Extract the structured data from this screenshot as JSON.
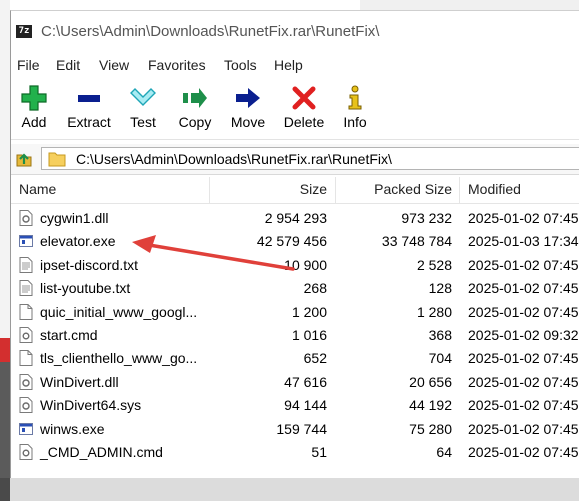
{
  "window": {
    "title": "C:\\Users\\Admin\\Downloads\\RunetFix.rar\\RunetFix\\",
    "app_icon_text": "7z"
  },
  "menu": [
    "File",
    "Edit",
    "View",
    "Favorites",
    "Tools",
    "Help"
  ],
  "toolbar": {
    "add": "Add",
    "extract": "Extract",
    "test": "Test",
    "copy": "Copy",
    "move": "Move",
    "delete": "Delete",
    "info": "Info"
  },
  "address": {
    "path": "C:\\Users\\Admin\\Downloads\\RunetFix.rar\\RunetFix\\"
  },
  "columns": {
    "name": "Name",
    "size": "Size",
    "packed": "Packed Size",
    "modified": "Modified"
  },
  "files": [
    {
      "name": "cygwin1.dll",
      "size": "2 954 293",
      "packed": "973 232",
      "modified": "2025-01-02 07:45",
      "icon": "dll-icon"
    },
    {
      "name": "elevator.exe",
      "size": "42 579 456",
      "packed": "33 748 784",
      "modified": "2025-01-03 17:34",
      "icon": "exe-icon"
    },
    {
      "name": "ipset-discord.txt",
      "size": "10 900",
      "packed": "2 528",
      "modified": "2025-01-02 07:45",
      "icon": "txt-icon"
    },
    {
      "name": "list-youtube.txt",
      "size": "268",
      "packed": "128",
      "modified": "2025-01-02 07:45",
      "icon": "txt-icon"
    },
    {
      "name": "quic_initial_www_googl...",
      "size": "1 200",
      "packed": "1 280",
      "modified": "2025-01-02 07:45",
      "icon": "file-icon"
    },
    {
      "name": "start.cmd",
      "size": "1 016",
      "packed": "368",
      "modified": "2025-01-02 09:32",
      "icon": "cmd-icon"
    },
    {
      "name": "tls_clienthello_www_go...",
      "size": "652",
      "packed": "704",
      "modified": "2025-01-02 07:45",
      "icon": "file-icon"
    },
    {
      "name": "WinDivert.dll",
      "size": "47 616",
      "packed": "20 656",
      "modified": "2025-01-02 07:45",
      "icon": "dll-icon"
    },
    {
      "name": "WinDivert64.sys",
      "size": "94 144",
      "packed": "44 192",
      "modified": "2025-01-02 07:45",
      "icon": "dll-icon"
    },
    {
      "name": "winws.exe",
      "size": "159 744",
      "packed": "75 280",
      "modified": "2025-01-02 07:45",
      "icon": "exe-icon"
    },
    {
      "name": "_CMD_ADMIN.cmd",
      "size": "51",
      "packed": "64",
      "modified": "2025-01-02 07:45",
      "icon": "cmd-icon"
    }
  ],
  "colors": {
    "annotation_arrow": "#e0403a",
    "add_green": "#22b14c",
    "delete_red": "#e02020",
    "navy": "#0a1f8f",
    "folder_yellow": "#f6cf5d"
  }
}
